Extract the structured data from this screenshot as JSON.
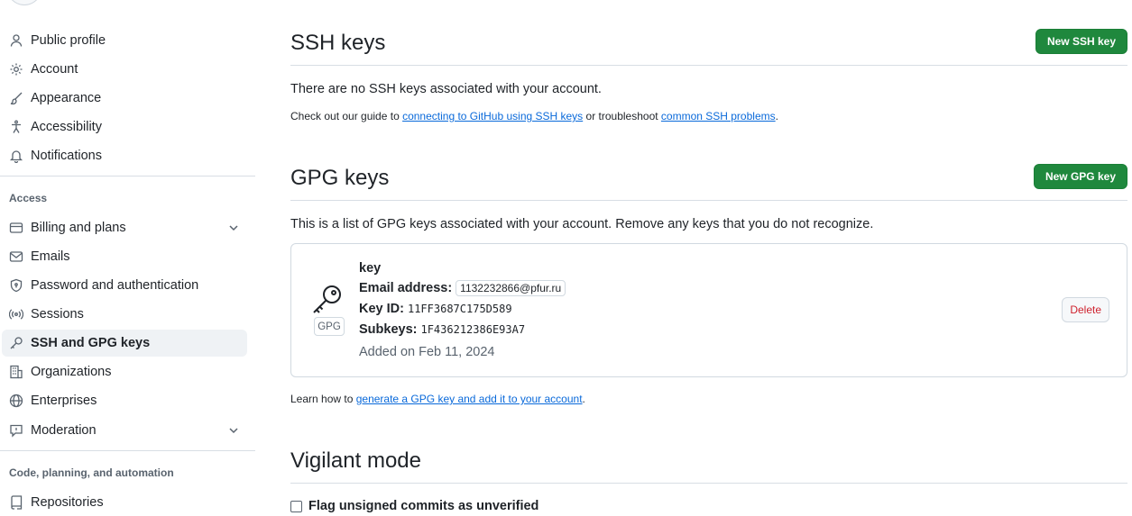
{
  "sidebar": {
    "items_top": [
      {
        "label": "Public profile",
        "icon": "person-icon"
      },
      {
        "label": "Account",
        "icon": "gear-icon"
      },
      {
        "label": "Appearance",
        "icon": "paintbrush-icon"
      },
      {
        "label": "Accessibility",
        "icon": "accessibility-icon"
      },
      {
        "label": "Notifications",
        "icon": "bell-icon"
      }
    ],
    "access_title": "Access",
    "items_access": [
      {
        "label": "Billing and plans",
        "icon": "credit-card-icon"
      },
      {
        "label": "Emails",
        "icon": "mail-icon"
      },
      {
        "label": "Password and authentication",
        "icon": "shield-lock-icon"
      },
      {
        "label": "Sessions",
        "icon": "broadcast-icon"
      },
      {
        "label": "SSH and GPG keys",
        "icon": "key-icon"
      },
      {
        "label": "Organizations",
        "icon": "organization-icon"
      },
      {
        "label": "Enterprises",
        "icon": "globe-icon"
      },
      {
        "label": "Moderation",
        "icon": "report-icon"
      }
    ],
    "code_title": "Code, planning, and automation",
    "items_code": [
      {
        "label": "Repositories",
        "icon": "repo-icon"
      }
    ]
  },
  "ssh": {
    "title": "SSH keys",
    "new_button": "New SSH key",
    "empty_text": "There are no SSH keys associated with your account.",
    "help_prefix": "Check out our guide to ",
    "help_link1": "connecting to GitHub using SSH keys",
    "help_mid": " or troubleshoot ",
    "help_link2": "common SSH problems",
    "help_suffix": "."
  },
  "gpg": {
    "title": "GPG keys",
    "new_button": "New GPG key",
    "description": "This is a list of GPG keys associated with your account. Remove any keys that you do not recognize.",
    "key": {
      "badge": "GPG",
      "name": "key",
      "email_label": "Email address:",
      "email": "1132232866@pfur.ru",
      "keyid_label": "Key ID:",
      "keyid": "11FF3687C175D589",
      "subkeys_label": "Subkeys:",
      "subkeys": "1F436212386E93A7",
      "added": "Added on Feb 11, 2024",
      "delete_button": "Delete"
    },
    "learn_prefix": "Learn how to ",
    "learn_link": "generate a GPG key and add it to your account",
    "learn_suffix": "."
  },
  "vigilant": {
    "title": "Vigilant mode",
    "checkbox_label": "Flag unsigned commits as unverified"
  }
}
